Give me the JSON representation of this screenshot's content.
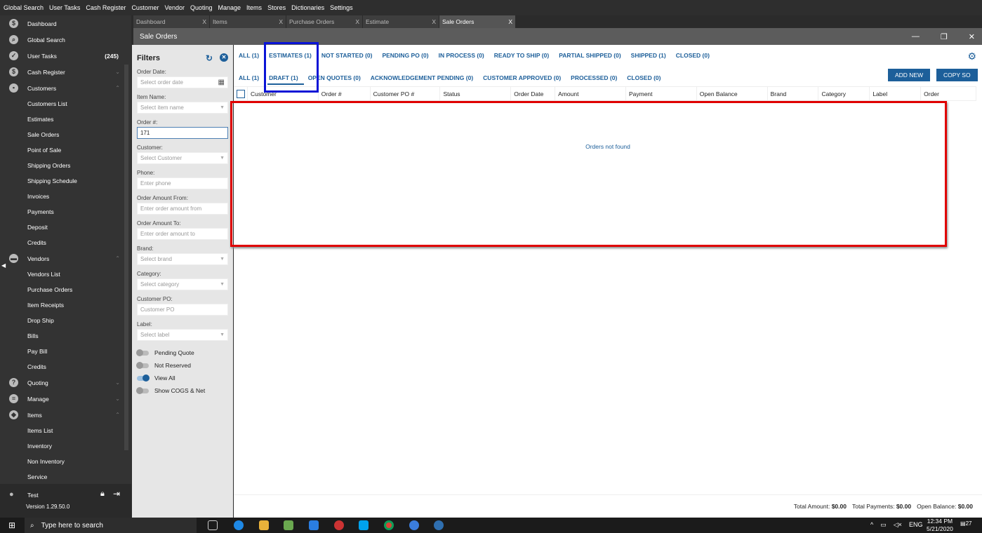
{
  "menu": [
    "Global Search",
    "User Tasks",
    "Cash Register",
    "Customer",
    "Vendor",
    "Quoting",
    "Manage",
    "Items",
    "Stores",
    "Dictionaries",
    "Settings"
  ],
  "sidebar": {
    "items": [
      {
        "label": "Dashboard",
        "type": "top",
        "icon": "dollar-circle-icon",
        "glyph": "$"
      },
      {
        "label": "Global Search",
        "type": "top",
        "icon": "search-icon",
        "glyph": "⌕"
      },
      {
        "label": "User Tasks",
        "type": "top",
        "icon": "check-circle-icon",
        "glyph": "✓",
        "count": "(245)"
      },
      {
        "label": "Cash Register",
        "type": "top",
        "icon": "dollar-circle-icon",
        "glyph": "$",
        "chev": "⌄"
      },
      {
        "label": "Customers",
        "type": "top",
        "icon": "customer-icon",
        "glyph": "▪",
        "chev": "⌃"
      },
      {
        "label": "Customers List",
        "type": "sub"
      },
      {
        "label": "Estimates",
        "type": "sub"
      },
      {
        "label": "Sale Orders",
        "type": "sub"
      },
      {
        "label": "Point of Sale",
        "type": "sub"
      },
      {
        "label": "Shipping Orders",
        "type": "sub"
      },
      {
        "label": "Shipping Schedule",
        "type": "sub"
      },
      {
        "label": "Invoices",
        "type": "sub"
      },
      {
        "label": "Payments",
        "type": "sub"
      },
      {
        "label": "Deposit",
        "type": "sub"
      },
      {
        "label": "Credits",
        "type": "sub"
      },
      {
        "label": "Vendors",
        "type": "top",
        "icon": "store-icon",
        "glyph": "▬",
        "chev": "⌃"
      },
      {
        "label": "Vendors List",
        "type": "sub"
      },
      {
        "label": "Purchase Orders",
        "type": "sub"
      },
      {
        "label": "Item Receipts",
        "type": "sub"
      },
      {
        "label": "Drop Ship",
        "type": "sub"
      },
      {
        "label": "Bills",
        "type": "sub"
      },
      {
        "label": "Pay Bill",
        "type": "sub"
      },
      {
        "label": "Credits",
        "type": "sub"
      },
      {
        "label": "Quoting",
        "type": "top",
        "icon": "quote-icon",
        "glyph": "?",
        "chev": "⌄"
      },
      {
        "label": "Manage",
        "type": "top",
        "icon": "clipboard-icon",
        "glyph": "≡",
        "chev": "⌄"
      },
      {
        "label": "Items",
        "type": "top",
        "icon": "tag-icon",
        "glyph": "◆",
        "chev": "⌃"
      },
      {
        "label": "Items List",
        "type": "sub"
      },
      {
        "label": "Inventory",
        "type": "sub"
      },
      {
        "label": "Non Inventory",
        "type": "sub"
      },
      {
        "label": "Service",
        "type": "sub"
      }
    ],
    "user": "Test",
    "version": "Version 1.29.50.0"
  },
  "tabs": [
    {
      "label": "Dashboard"
    },
    {
      "label": "Items"
    },
    {
      "label": "Purchase Orders"
    },
    {
      "label": "Estimate"
    },
    {
      "label": "Sale Orders",
      "active": true
    }
  ],
  "window": {
    "title": "Sale Orders"
  },
  "filters": {
    "title": "Filters",
    "fields": [
      {
        "label": "Order Date:",
        "placeholder": "Select order date",
        "kind": "date"
      },
      {
        "label": "Item Name:",
        "placeholder": "Select item name",
        "kind": "select"
      },
      {
        "label": "Order #:",
        "value": "171",
        "kind": "text"
      },
      {
        "label": "Customer:",
        "placeholder": "Select Customer",
        "kind": "select"
      },
      {
        "label": "Phone:",
        "placeholder": "Enter phone",
        "kind": "text"
      },
      {
        "label": "Order Amount From:",
        "placeholder": "Enter order amount from",
        "kind": "text"
      },
      {
        "label": "Order Amount To:",
        "placeholder": "Enter order amount to",
        "kind": "text"
      },
      {
        "label": "Brand:",
        "placeholder": "Select brand",
        "kind": "select"
      },
      {
        "label": "Category:",
        "placeholder": "Select category",
        "kind": "select"
      },
      {
        "label": "Customer PO:",
        "placeholder": "Customer PO",
        "kind": "text"
      },
      {
        "label": "Label:",
        "placeholder": "Select label",
        "kind": "select"
      }
    ],
    "toggles": [
      {
        "label": "Pending Quote",
        "on": false
      },
      {
        "label": "Not Reserved",
        "on": false
      },
      {
        "label": "View All",
        "on": true
      },
      {
        "label": "Show COGS & Net",
        "on": false
      }
    ]
  },
  "status_tabs": [
    "ALL (1)",
    "ESTIMATES (1)",
    "NOT STARTED (0)",
    "PENDING PO (0)",
    "IN PROCESS (0)",
    "READY TO SHIP (0)",
    "PARTIAL SHIPPED (0)",
    "SHIPPED (1)",
    "CLOSED (0)"
  ],
  "sub_tabs": [
    "ALL (1)",
    "DRAFT (1)",
    "OPEN QUOTES (0)",
    "ACKNOWLEDGEMENT PENDING (0)",
    "CUSTOMER APPROVED (0)",
    "PROCESSED (0)",
    "CLOSED (0)"
  ],
  "buttons": {
    "add_new": "ADD NEW",
    "copy_so": "COPY SO"
  },
  "columns": [
    "Customer",
    "Order #",
    "Customer PO #",
    "Status",
    "Order Date",
    "Amount",
    "Payment",
    "Open Balance",
    "Brand",
    "Category",
    "Label",
    "Order"
  ],
  "empty_message": "Orders not found",
  "totals": {
    "amount_label": "Total Amount:",
    "amount": "$0.00",
    "payments_label": "Total Payments:",
    "payments": "$0.00",
    "balance_label": "Open Balance:",
    "balance": "$0.00"
  },
  "taskbar": {
    "search_placeholder": "Type here to search",
    "language": "ENG",
    "time": "12:34 PM",
    "date": "5/21/2020",
    "notifications": "27"
  },
  "colors": {
    "accent": "#1d5f9a",
    "highlight_blue": "#0a14d6",
    "highlight_red": "#e00000"
  }
}
